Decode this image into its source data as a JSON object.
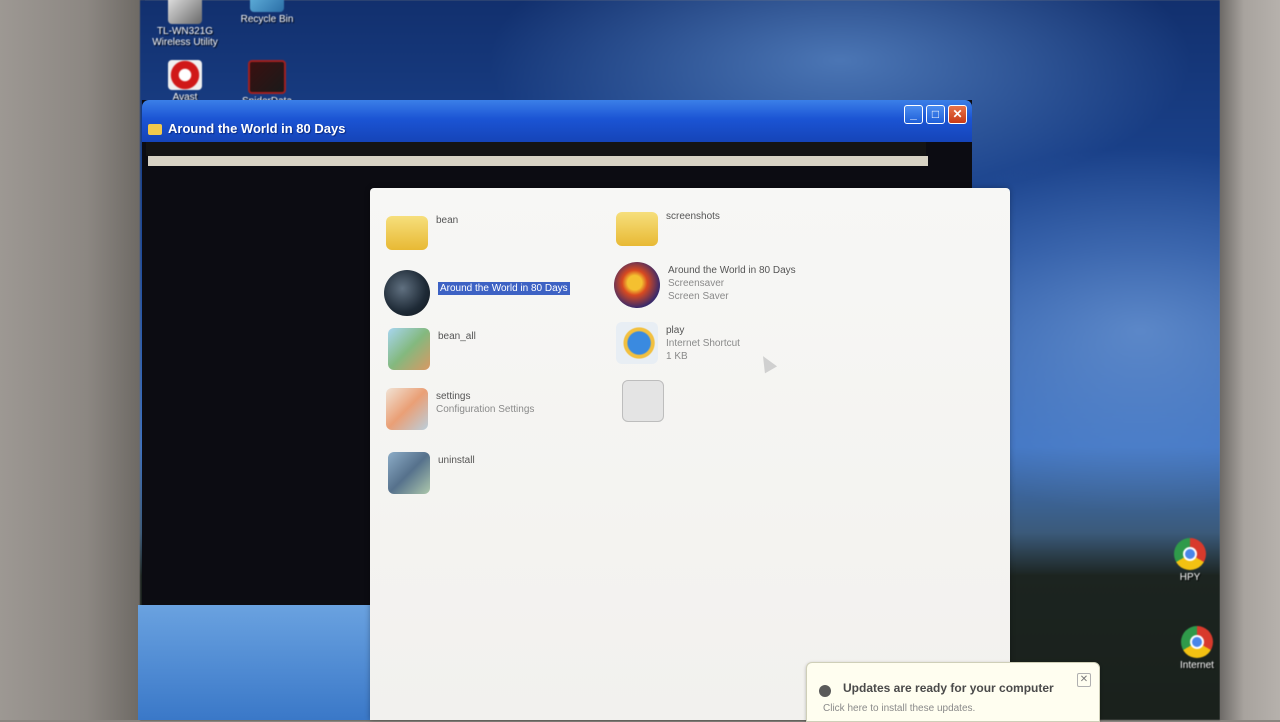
{
  "desktop": {
    "icons": [
      {
        "label": "TL-WN321G Wireless Utility",
        "icon": "wireless-icon"
      },
      {
        "label": "Recycle Bin",
        "icon": "recycle-bin-icon"
      },
      {
        "label": "Avast",
        "icon": "avast-icon"
      },
      {
        "label": "SpiderData",
        "icon": "spider-icon"
      },
      {
        "label": "HPY",
        "icon": "chrome-icon"
      },
      {
        "label": "Internet",
        "icon": "chrome-icon"
      }
    ]
  },
  "window": {
    "title": "Around the World in 80 Days",
    "buttons": {
      "minimize": "_",
      "maximize": "□",
      "close": "✕"
    }
  },
  "dialog": {
    "items": [
      {
        "name": "bean",
        "line2": "",
        "line3": "",
        "icon": "folder-icon"
      },
      {
        "name": "screenshots",
        "line2": "",
        "line3": "",
        "icon": "folder-icon"
      },
      {
        "name": "Around the World in 80 Days",
        "line2": "",
        "line3": "",
        "icon": "globe-icon"
      },
      {
        "name": "Around the World in 80 Days",
        "line2": "Screensaver",
        "line3": "Screen Saver",
        "icon": "screensaver-icon"
      },
      {
        "name": "bean_all",
        "line2": "",
        "line3": "",
        "icon": "image-icon"
      },
      {
        "name": "play",
        "line2": "Internet Shortcut",
        "line3": "1 KB",
        "icon": "internet-explorer-icon"
      },
      {
        "name": "settings",
        "line2": "Configuration Settings",
        "line3": "",
        "icon": "settings-icon"
      },
      {
        "name": "",
        "line2": "",
        "line3": "",
        "icon": "file-icon"
      },
      {
        "name": "uninstall",
        "line2": "",
        "line3": "",
        "icon": "setup-icon"
      }
    ]
  },
  "notification": {
    "title": "Updates are ready for your computer",
    "body": "Click here to install these updates.",
    "close": "✕"
  }
}
